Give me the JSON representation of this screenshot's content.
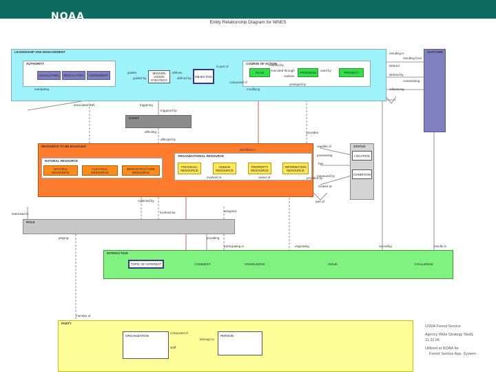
{
  "header": {
    "logo": "NOAA",
    "title": "Entity Relationship Diagram for WNES"
  },
  "packages": {
    "leadership": "LEADERSHIP AND MANAGEMENT",
    "authority": "AUTHORITY",
    "course_of_action": "COURSE OF ACTION",
    "outcome": "OUTCOME",
    "event": "EVENT",
    "resource": "RESOURCE TO BE MANAGED",
    "natural_resource": "NATURAL RESOURCE",
    "org_resource": "ORGANIZATIONAL RESOURCE",
    "status": "STATUS",
    "role": "ROLE",
    "interaction": "INTERACTION",
    "party": "PARTY"
  },
  "entities": {
    "legislation": "LEGISLATION",
    "regulation": "REGULATION",
    "agreement": "AGREEMENT",
    "mission_vision_strategy": "MISSION VISION STRATEGY",
    "objective": "OBJECTIVE",
    "plan": "PLAN",
    "program": "PROGRAM",
    "project": "PROJECT",
    "natural_resource": "NATURAL RESOURCE",
    "cultural_resource": "CULTURAL RESOURCE",
    "infrastructure_resource": "INFRASTRUCTURE RESOURCE",
    "financial_resource": "FINANCIAL RESOURCE",
    "human_resource": "HUMAN RESOURCE",
    "property_resource": "PROPERTY RESOURCE",
    "information_resource": "INFORMATION RESOURCE",
    "location": "LOCATION",
    "condition": "CONDITION",
    "topic_of_interest": "TOPIC OF INTEREST",
    "comment": "COMMENT",
    "knowledge": "KNOWLEDGE",
    "issue": "ISSUE",
    "challenge": "CHALLENGE",
    "organization": "ORGANIZATION",
    "person": "PERSON"
  },
  "relations": {
    "guides": "guides",
    "guided_by": "guided by",
    "defines": "defines",
    "defined_by": "defined by",
    "mandating": "mandating",
    "is_part_of": "is part of",
    "composed_of": "composed of",
    "executed_through": "executed through",
    "realizes": "realizes",
    "realized_by": "realized by",
    "arranged_by": "arranged by",
    "used_by": "used by",
    "resulting_in": "resulting in",
    "resulting_from": "resulting from",
    "desired": "desired",
    "desired_by": "desired by",
    "constraining": "constraining",
    "triggering": "triggering",
    "triggered_by": "triggered by",
    "affecting": "affecting",
    "affected_by": "affected by",
    "influencing": "influencing",
    "modifying": "modifying",
    "capable_of": "capable of",
    "possessing": "possessing",
    "located_at": "located at",
    "identified_in": "identified in",
    "involved_in": "involved in",
    "owner_of": "owner of",
    "provides": "provides",
    "provided_by": "provided by",
    "associated_with": "associated with",
    "collected_by": "collected by",
    "involved_as": "involved as",
    "assigned": "assigned",
    "playing": "playing",
    "providing": "providing",
    "participating_in": "participating in",
    "originating": "originating",
    "recording": "recording",
    "results_in": "results in",
    "part_of": "part of",
    "composed_of_party": "composed of",
    "staff": "staff",
    "belongs_to": "belongs to",
    "member_of": "member of",
    "interested_in": "interested in",
    "measured_by": "measured by",
    "has": "has"
  },
  "notes": {
    "line1": "USDA Forest Service",
    "line2": "Agency Wide Strategy Study",
    "line3": "11.22.06",
    "line4": "Utilized at NOAA for",
    "line5": "Forest Service App. System"
  }
}
